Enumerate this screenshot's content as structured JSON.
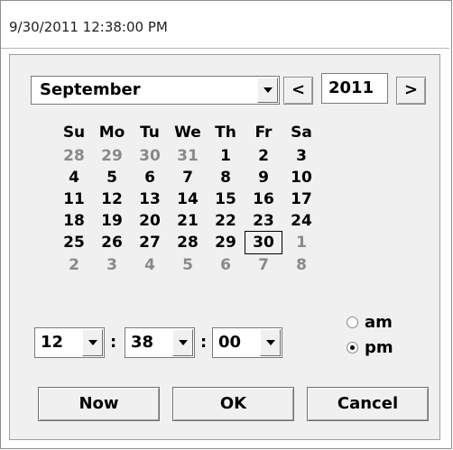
{
  "title": "9/30/2011 12:38:00 PM",
  "month_select": {
    "value": "September"
  },
  "nav": {
    "prev": "<",
    "next": ">"
  },
  "year": "2011",
  "weekdays": [
    "Su",
    "Mo",
    "Tu",
    "We",
    "Th",
    "Fr",
    "Sa"
  ],
  "weeks": [
    [
      {
        "d": "28",
        "other": true
      },
      {
        "d": "29",
        "other": true
      },
      {
        "d": "30",
        "other": true
      },
      {
        "d": "31",
        "other": true
      },
      {
        "d": "1"
      },
      {
        "d": "2"
      },
      {
        "d": "3"
      }
    ],
    [
      {
        "d": "4"
      },
      {
        "d": "5"
      },
      {
        "d": "6"
      },
      {
        "d": "7"
      },
      {
        "d": "8"
      },
      {
        "d": "9"
      },
      {
        "d": "10"
      }
    ],
    [
      {
        "d": "11"
      },
      {
        "d": "12"
      },
      {
        "d": "13"
      },
      {
        "d": "14"
      },
      {
        "d": "15"
      },
      {
        "d": "16"
      },
      {
        "d": "17"
      }
    ],
    [
      {
        "d": "18"
      },
      {
        "d": "19"
      },
      {
        "d": "20"
      },
      {
        "d": "21"
      },
      {
        "d": "22"
      },
      {
        "d": "23"
      },
      {
        "d": "24"
      }
    ],
    [
      {
        "d": "25"
      },
      {
        "d": "26"
      },
      {
        "d": "27"
      },
      {
        "d": "28"
      },
      {
        "d": "29"
      },
      {
        "d": "30",
        "selected": true
      },
      {
        "d": "1",
        "other": true
      }
    ],
    [
      {
        "d": "2",
        "other": true
      },
      {
        "d": "3",
        "other": true
      },
      {
        "d": "4",
        "other": true
      },
      {
        "d": "5",
        "other": true
      },
      {
        "d": "6",
        "other": true
      },
      {
        "d": "7",
        "other": true
      },
      {
        "d": "8",
        "other": true
      }
    ]
  ],
  "time": {
    "hour": "12",
    "minute": "38",
    "second": "00",
    "separator": ":"
  },
  "ampm": {
    "am_label": "am",
    "pm_label": "pm",
    "selected": "pm"
  },
  "buttons": {
    "now": "Now",
    "ok": "OK",
    "cancel": "Cancel"
  }
}
